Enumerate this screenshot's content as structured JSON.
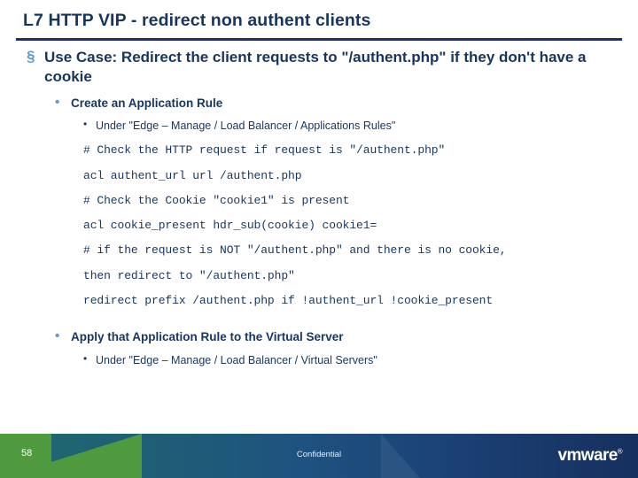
{
  "slide": {
    "title": "L7 HTTP VIP - redirect non authent clients",
    "bullets": {
      "l1": "Use Case: Redirect the client requests to \"/authent.php\" if they don't have a cookie",
      "l2_a": "Create an Application Rule",
      "l3_a": "Under \"Edge – Manage /  Load Balancer / Applications Rules\"",
      "l2_b": "Apply that Application Rule to the Virtual Server",
      "l3_b": "Under \"Edge – Manage /  Load Balancer / Virtual Servers\""
    },
    "code_lines": [
      "# Check the HTTP request if request is \"/authent.php\"",
      "acl authent_url url /authent.php",
      "# Check the Cookie \"cookie1\" is present",
      "acl cookie_present hdr_sub(cookie) cookie1=",
      "# if the request is NOT \"/authent.php\" and there is no cookie,",
      "then redirect to \"/authent.php\"",
      "redirect prefix /authent.php if !authent_url !cookie_present"
    ],
    "markers": {
      "square": "§",
      "dot_medium": "•",
      "dot_small": "•"
    }
  },
  "footer": {
    "page_number": "58",
    "confidential": "Confidential",
    "logo": "vmware",
    "logo_reg": "®"
  }
}
